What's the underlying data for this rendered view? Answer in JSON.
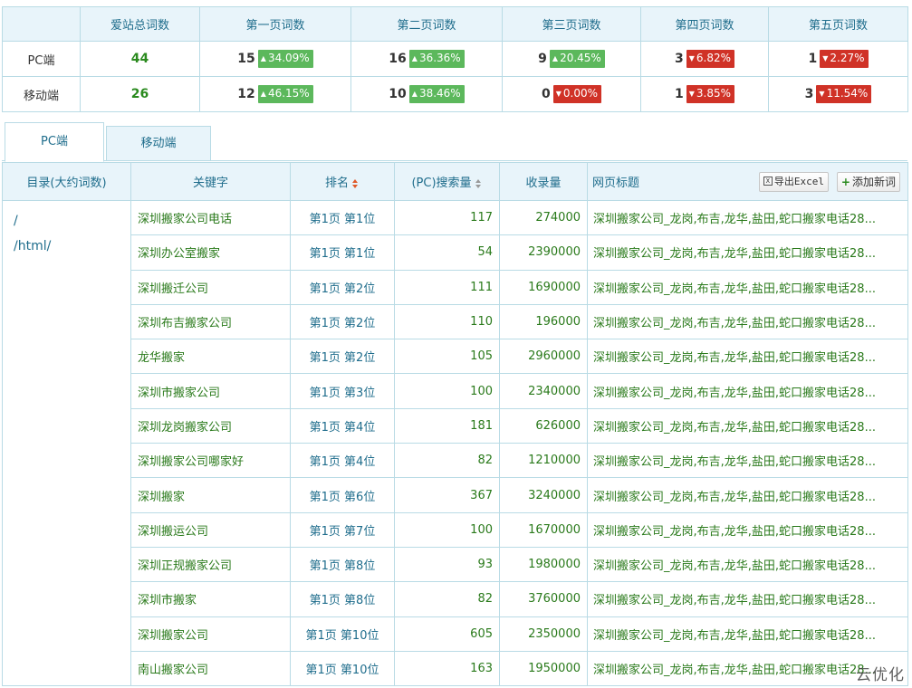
{
  "summary": {
    "headers": [
      "",
      "爱站总词数",
      "第一页词数",
      "第二页词数",
      "第三页词数",
      "第四页词数",
      "第五页词数"
    ],
    "rows": [
      {
        "label": "PC端",
        "total": "44",
        "pages": [
          {
            "count": "15",
            "pct": "34.09%",
            "dir": "up"
          },
          {
            "count": "16",
            "pct": "36.36%",
            "dir": "up"
          },
          {
            "count": "9",
            "pct": "20.45%",
            "dir": "up"
          },
          {
            "count": "3",
            "pct": "6.82%",
            "dir": "down"
          },
          {
            "count": "1",
            "pct": "2.27%",
            "dir": "down"
          }
        ]
      },
      {
        "label": "移动端",
        "total": "26",
        "pages": [
          {
            "count": "12",
            "pct": "46.15%",
            "dir": "up"
          },
          {
            "count": "10",
            "pct": "38.46%",
            "dir": "up"
          },
          {
            "count": "0",
            "pct": "0.00%",
            "dir": "down"
          },
          {
            "count": "1",
            "pct": "3.85%",
            "dir": "down"
          },
          {
            "count": "3",
            "pct": "11.54%",
            "dir": "down"
          }
        ]
      }
    ]
  },
  "tabs": [
    "PC端",
    "移动端"
  ],
  "table": {
    "headers": {
      "dir": "目录(大约词数)",
      "keyword": "关键字",
      "rank": "排名",
      "volume": "(PC)搜索量",
      "indexed": "收录量",
      "title": "网页标题"
    },
    "buttons": {
      "export": "导出Excel",
      "add": "添加新词"
    },
    "dirs": [
      "/",
      "/html/"
    ],
    "rows": [
      {
        "kw": "深圳搬家公司电话",
        "rank": "第1页 第1位",
        "vol": "117",
        "idx": "274000",
        "title": "深圳搬家公司_龙岗,布吉,龙华,盐田,蛇口搬家电话28..."
      },
      {
        "kw": "深圳办公室搬家",
        "rank": "第1页 第1位",
        "vol": "54",
        "idx": "2390000",
        "title": "深圳搬家公司_龙岗,布吉,龙华,盐田,蛇口搬家电话28..."
      },
      {
        "kw": "深圳搬迁公司",
        "rank": "第1页 第2位",
        "vol": "111",
        "idx": "1690000",
        "title": "深圳搬家公司_龙岗,布吉,龙华,盐田,蛇口搬家电话28..."
      },
      {
        "kw": "深圳布吉搬家公司",
        "rank": "第1页 第2位",
        "vol": "110",
        "idx": "196000",
        "title": "深圳搬家公司_龙岗,布吉,龙华,盐田,蛇口搬家电话28..."
      },
      {
        "kw": "龙华搬家",
        "rank": "第1页 第2位",
        "vol": "105",
        "idx": "2960000",
        "title": "深圳搬家公司_龙岗,布吉,龙华,盐田,蛇口搬家电话28..."
      },
      {
        "kw": "深圳市搬家公司",
        "rank": "第1页 第3位",
        "vol": "100",
        "idx": "2340000",
        "title": "深圳搬家公司_龙岗,布吉,龙华,盐田,蛇口搬家电话28..."
      },
      {
        "kw": "深圳龙岗搬家公司",
        "rank": "第1页 第4位",
        "vol": "181",
        "idx": "626000",
        "title": "深圳搬家公司_龙岗,布吉,龙华,盐田,蛇口搬家电话28..."
      },
      {
        "kw": "深圳搬家公司哪家好",
        "rank": "第1页 第4位",
        "vol": "82",
        "idx": "1210000",
        "title": "深圳搬家公司_龙岗,布吉,龙华,盐田,蛇口搬家电话28..."
      },
      {
        "kw": "深圳搬家",
        "rank": "第1页 第6位",
        "vol": "367",
        "idx": "3240000",
        "title": "深圳搬家公司_龙岗,布吉,龙华,盐田,蛇口搬家电话28..."
      },
      {
        "kw": "深圳搬运公司",
        "rank": "第1页 第7位",
        "vol": "100",
        "idx": "1670000",
        "title": "深圳搬家公司_龙岗,布吉,龙华,盐田,蛇口搬家电话28..."
      },
      {
        "kw": "深圳正规搬家公司",
        "rank": "第1页 第8位",
        "vol": "93",
        "idx": "1980000",
        "title": "深圳搬家公司_龙岗,布吉,龙华,盐田,蛇口搬家电话28..."
      },
      {
        "kw": "深圳市搬家",
        "rank": "第1页 第8位",
        "vol": "82",
        "idx": "3760000",
        "title": "深圳搬家公司_龙岗,布吉,龙华,盐田,蛇口搬家电话28..."
      },
      {
        "kw": "深圳搬家公司",
        "rank": "第1页 第10位",
        "vol": "605",
        "idx": "2350000",
        "title": "深圳搬家公司_龙岗,布吉,龙华,盐田,蛇口搬家电话28..."
      },
      {
        "kw": "南山搬家公司",
        "rank": "第1页 第10位",
        "vol": "163",
        "idx": "1950000",
        "title": "深圳搬家公司_龙岗,布吉,龙华,盐田,蛇口搬家电话28..."
      }
    ]
  },
  "watermark": "云优化",
  "colors": {
    "up": "#5cb85c",
    "down": "#d03227",
    "accent": "#1f6d8c",
    "value": "#2a7a1b",
    "border": "#b9dbe5",
    "header_bg": "#e8f4fa"
  }
}
